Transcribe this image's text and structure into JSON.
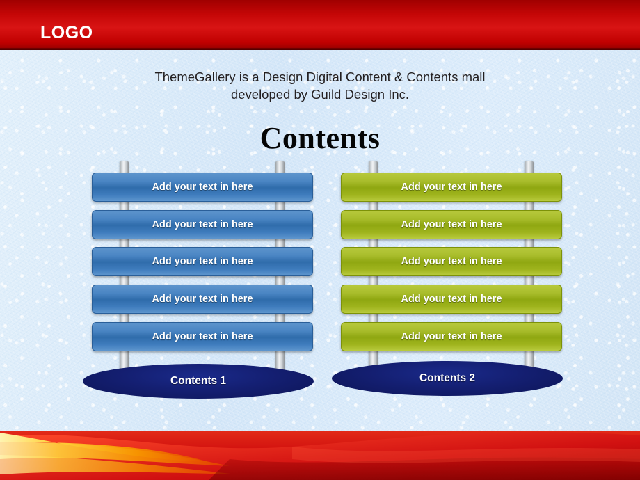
{
  "header": {
    "logo": "LOGO",
    "bar_color": "#c40606"
  },
  "body": {
    "subtitle_line1": "ThemeGallery is a Design Digital Content & Contents mall",
    "subtitle_line2": "developed by Guild Design Inc.",
    "title": "Contents"
  },
  "groups": [
    {
      "id": "contents-1",
      "base_label": "Contents 1",
      "color": "#3f7cbd",
      "planks": [
        "Add your text in here",
        "Add your text in here",
        "Add your text in here",
        "Add your text in here",
        "Add your text in here"
      ]
    },
    {
      "id": "contents-2",
      "base_label": "Contents 2",
      "color": "#9fb41d",
      "planks": [
        "Add your text in here",
        "Add your text in here",
        "Add your text in here",
        "Add your text in here",
        "Add your text in here"
      ]
    }
  ],
  "footer": {
    "primary_color": "#d81414",
    "accent_color": "#f6a800"
  }
}
